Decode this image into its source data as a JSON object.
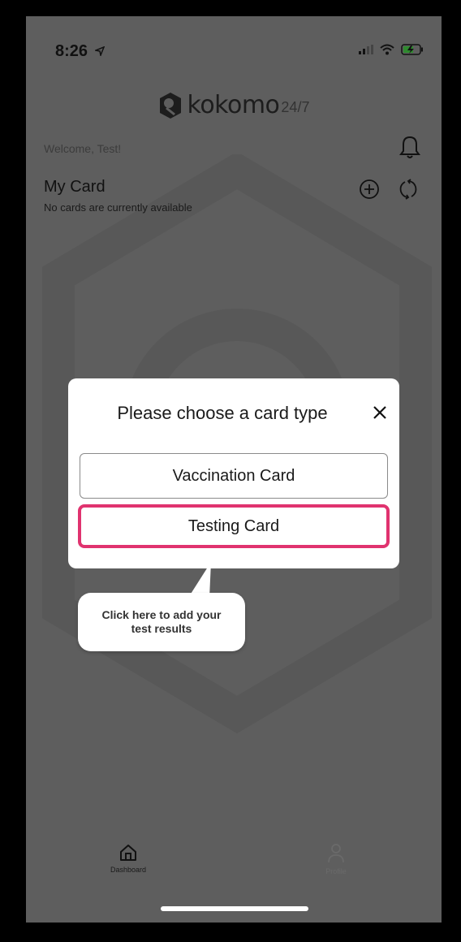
{
  "status_bar": {
    "time": "8:26",
    "icons": [
      "location-arrow-icon",
      "signal-icon",
      "wifi-icon",
      "battery-charging-icon"
    ]
  },
  "logo": {
    "brand": "kokomo",
    "suffix": "24/7"
  },
  "header": {
    "welcome": "Welcome, Test!"
  },
  "my_card": {
    "title": "My Card",
    "subtitle": "No cards are currently available"
  },
  "modal": {
    "title": "Please choose a card type",
    "options": [
      {
        "label": "Vaccination Card"
      },
      {
        "label": "Testing Card"
      }
    ]
  },
  "callout": {
    "line1": "Click here to add your",
    "line2": "test results"
  },
  "tabs": [
    {
      "label": "Dashboard",
      "icon": "home-icon"
    },
    {
      "label": "Profile",
      "icon": "person-icon"
    }
  ],
  "colors": {
    "highlight": "#e0336f",
    "overlay": "#5e5e5e"
  }
}
